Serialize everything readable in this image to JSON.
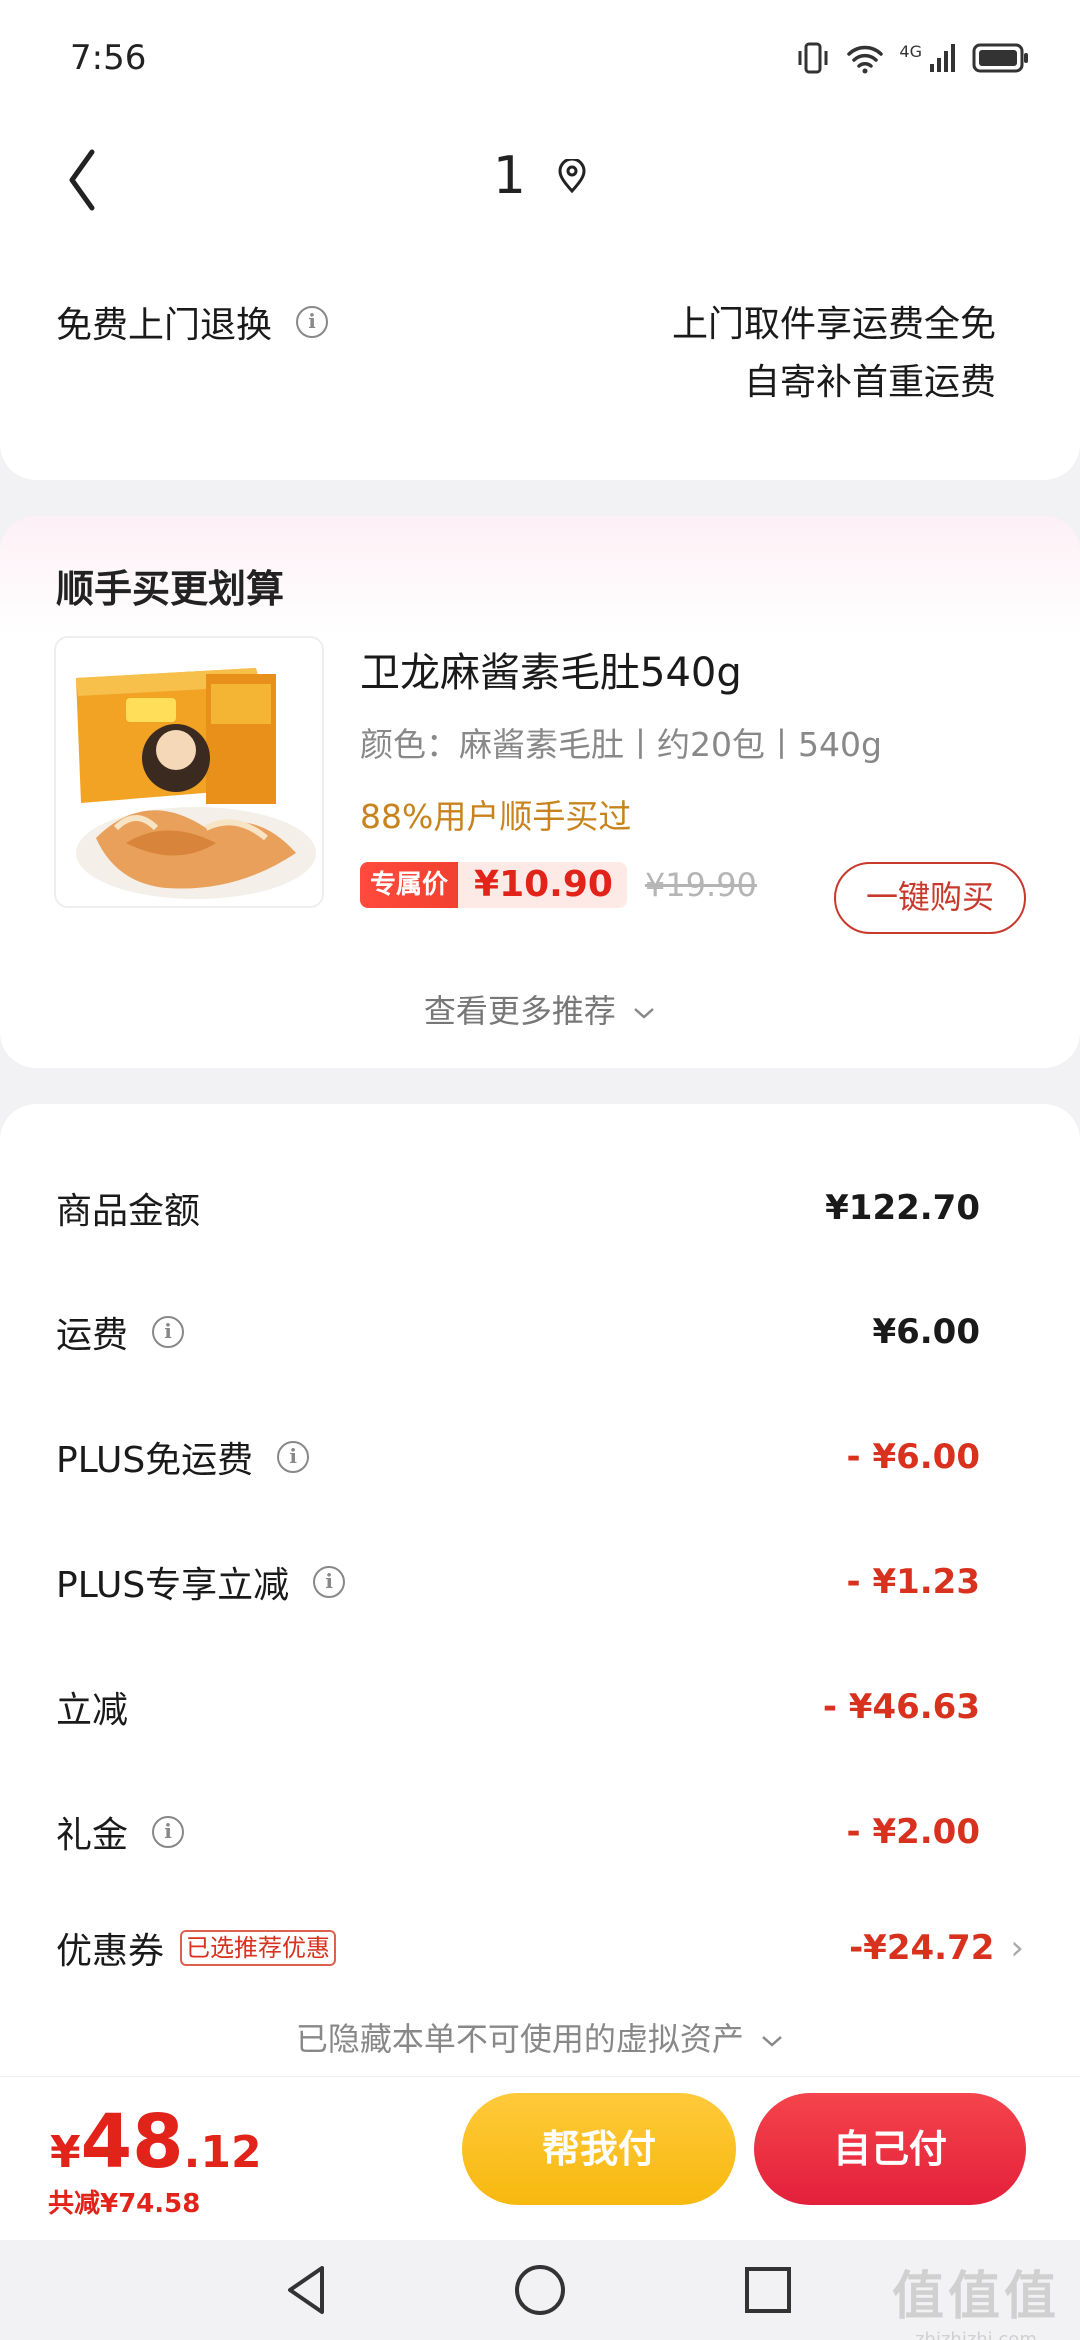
{
  "status": {
    "time": "7:56",
    "network": "4G"
  },
  "header": {
    "title": "1"
  },
  "return_info": {
    "label": "免费上门退换",
    "line1": "上门取件享运费全免",
    "line2": "自寄补首重运费"
  },
  "recommend": {
    "title": "顺手买更划算",
    "product": {
      "name": "卫龙麻酱素毛肚540g",
      "spec": "颜色：麻酱素毛肚丨约20包丨540g",
      "bought": "88%用户顺手买过",
      "price_tag": "专属价",
      "price": "¥10.90",
      "original_price": "¥19.90",
      "buy_label": "一键购买"
    },
    "more_label": "查看更多推荐"
  },
  "summary": {
    "rows": [
      {
        "label": "商品金额",
        "value": "¥122.70"
      },
      {
        "label": "运费",
        "value": "¥6.00"
      },
      {
        "label": "PLUS免运费",
        "value": "- ¥6.00"
      },
      {
        "label": "PLUS专享立减",
        "value": "- ¥1.23"
      },
      {
        "label": "立减",
        "value": "- ¥46.63"
      },
      {
        "label": "礼金",
        "value": "- ¥2.00"
      },
      {
        "label": "优惠券",
        "badge": "已选推荐优惠",
        "value": "-¥24.72"
      }
    ],
    "hidden_note": "已隐藏本单不可使用的虚拟资产"
  },
  "bottom": {
    "currency": "¥",
    "total_int": "48",
    "total_dec": ".12",
    "saved": "共减¥74.58",
    "help_pay": "帮我付",
    "self_pay": "自己付"
  },
  "watermark": {
    "mark": "值值值",
    "site": "zhizhizhi.com"
  },
  "colors": {
    "accent_red": "#e2231a",
    "gold": "#f7b90f",
    "muted": "#888888"
  }
}
